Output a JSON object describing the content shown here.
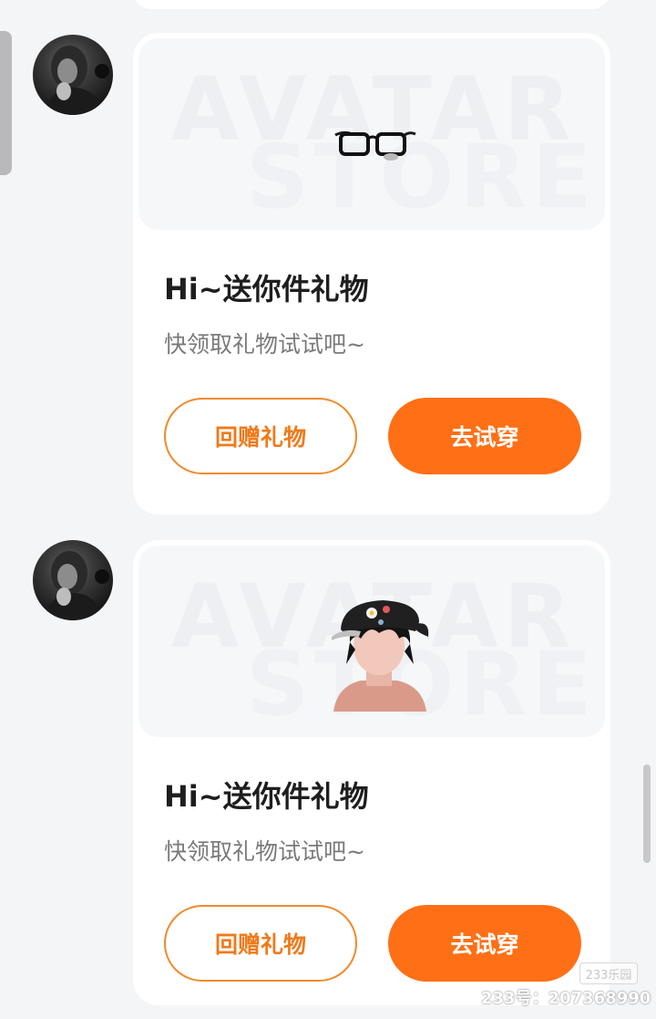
{
  "messages": [
    {
      "gift_icon": "glasses-icon",
      "banner_watermark": {
        "line1": "AVATAR",
        "line2": "STORE"
      },
      "title": "Hi~送你件礼物",
      "subtitle": "快领取礼物试试吧~",
      "return_gift_label": "回赠礼物",
      "try_on_label": "去试穿"
    },
    {
      "gift_icon": "avatar-with-cap-icon",
      "banner_watermark": {
        "line1": "AVATAR",
        "line2": "STORE"
      },
      "title": "Hi~送你件礼物",
      "subtitle": "快领取礼物试试吧~",
      "return_gift_label": "回赠礼物",
      "try_on_label": "去试穿"
    }
  ],
  "footer_watermark": {
    "logo": "233乐园",
    "id_text": "233号：207368990"
  },
  "colors": {
    "accent": "#ff7016",
    "outline": "#f08a2a",
    "title": "#1e1e1e",
    "subtitle": "#7a7a7a",
    "background": "#f4f5f7"
  }
}
